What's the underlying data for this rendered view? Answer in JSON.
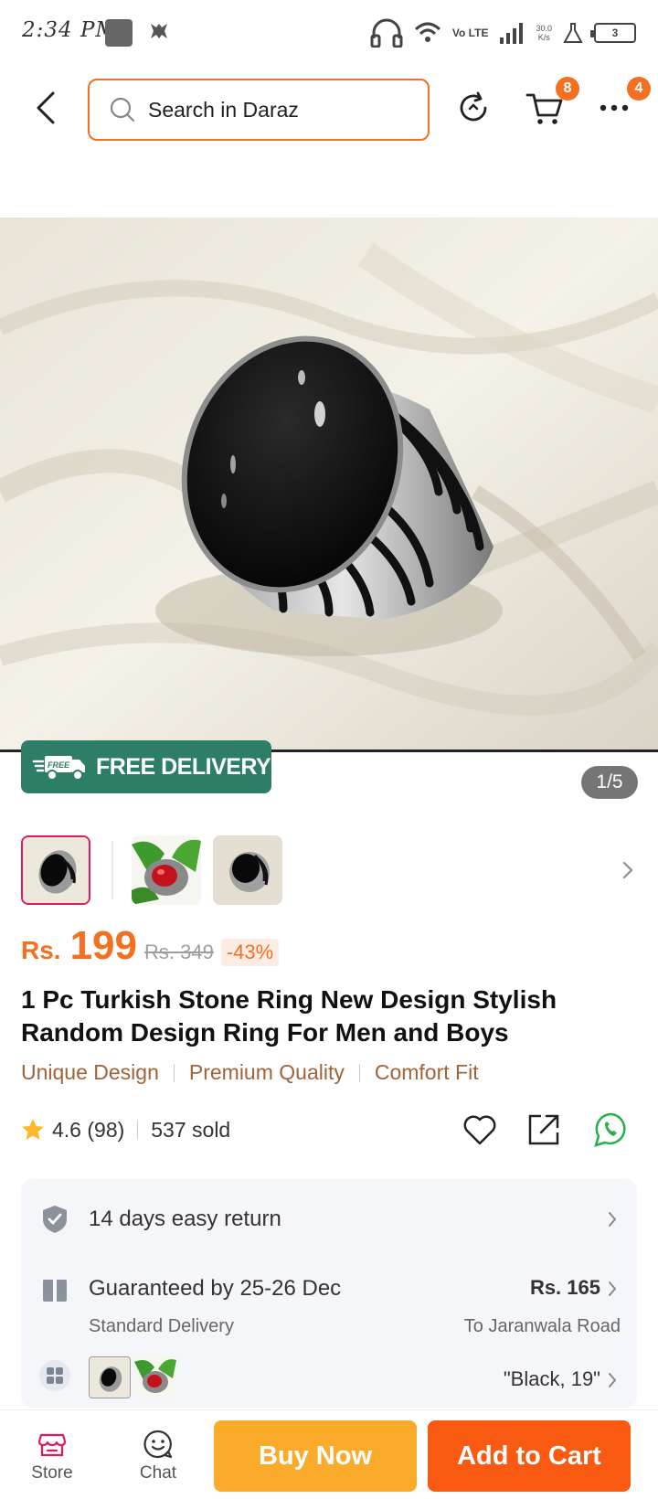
{
  "status_bar": {
    "time": "2:34 PM",
    "network": "Vo LTE",
    "speed_value": "30.0",
    "speed_unit": "K/s",
    "battery": "3"
  },
  "header": {
    "search_placeholder": "Search in Daraz",
    "cart_count": "8",
    "more_count": "4"
  },
  "gallery": {
    "free_delivery_badge": "FREE",
    "free_delivery_label": "FREE DELIVERY",
    "page_counter": "1/5"
  },
  "price": {
    "currency": "Rs.",
    "current": "199",
    "original": "Rs. 349",
    "discount": "-43%"
  },
  "product": {
    "title": "1 Pc Turkish Stone Ring New Design Stylish Random Design Ring For Men and Boys",
    "features": [
      "Unique Design",
      "Premium Quality",
      "Comfort Fit"
    ],
    "rating": "4.6 (98)",
    "sold": "537 sold"
  },
  "services": {
    "return_text": "14 days easy return",
    "delivery_text": "Guaranteed by 25-26 Dec",
    "delivery_sub": "Standard Delivery",
    "delivery_price": "Rs. 165",
    "delivery_location": "To Jaranwala Road",
    "variant_text": "\"Black, 19\""
  },
  "bottom_bar": {
    "store_label": "Store",
    "chat_label": "Chat",
    "buy_now_label": "Buy Now",
    "add_to_cart_label": "Add to Cart"
  },
  "colors": {
    "accent": "#f36f21",
    "buy_now": "#fbab2c",
    "add_to_cart": "#f85a12",
    "free_delivery": "#2e7d67"
  }
}
